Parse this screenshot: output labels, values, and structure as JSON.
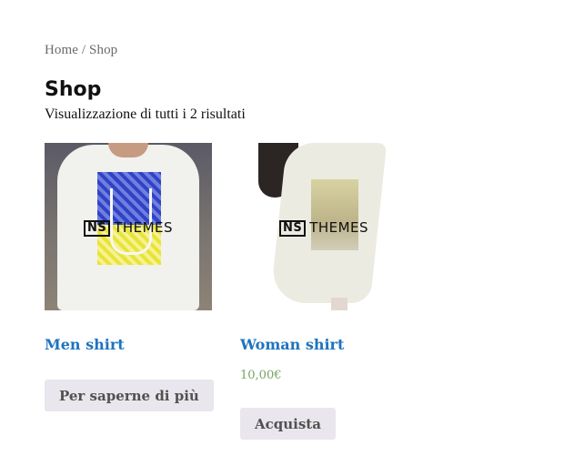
{
  "breadcrumb": {
    "home": "Home",
    "separator": " / ",
    "current": "Shop"
  },
  "page": {
    "title": "Shop",
    "result_count": "Visualizzazione di tutti i 2 risultati"
  },
  "watermark": {
    "mark": "NS",
    "text": "THEMES"
  },
  "products": [
    {
      "title": "Men shirt",
      "price": "",
      "button": "Per saperne di più"
    },
    {
      "title": "Woman shirt",
      "price": "10,00€",
      "button": "Acquista"
    }
  ],
  "colors": {
    "link": "#1e73be",
    "price": "#77a464",
    "button_bg": "#e9e6ed"
  }
}
